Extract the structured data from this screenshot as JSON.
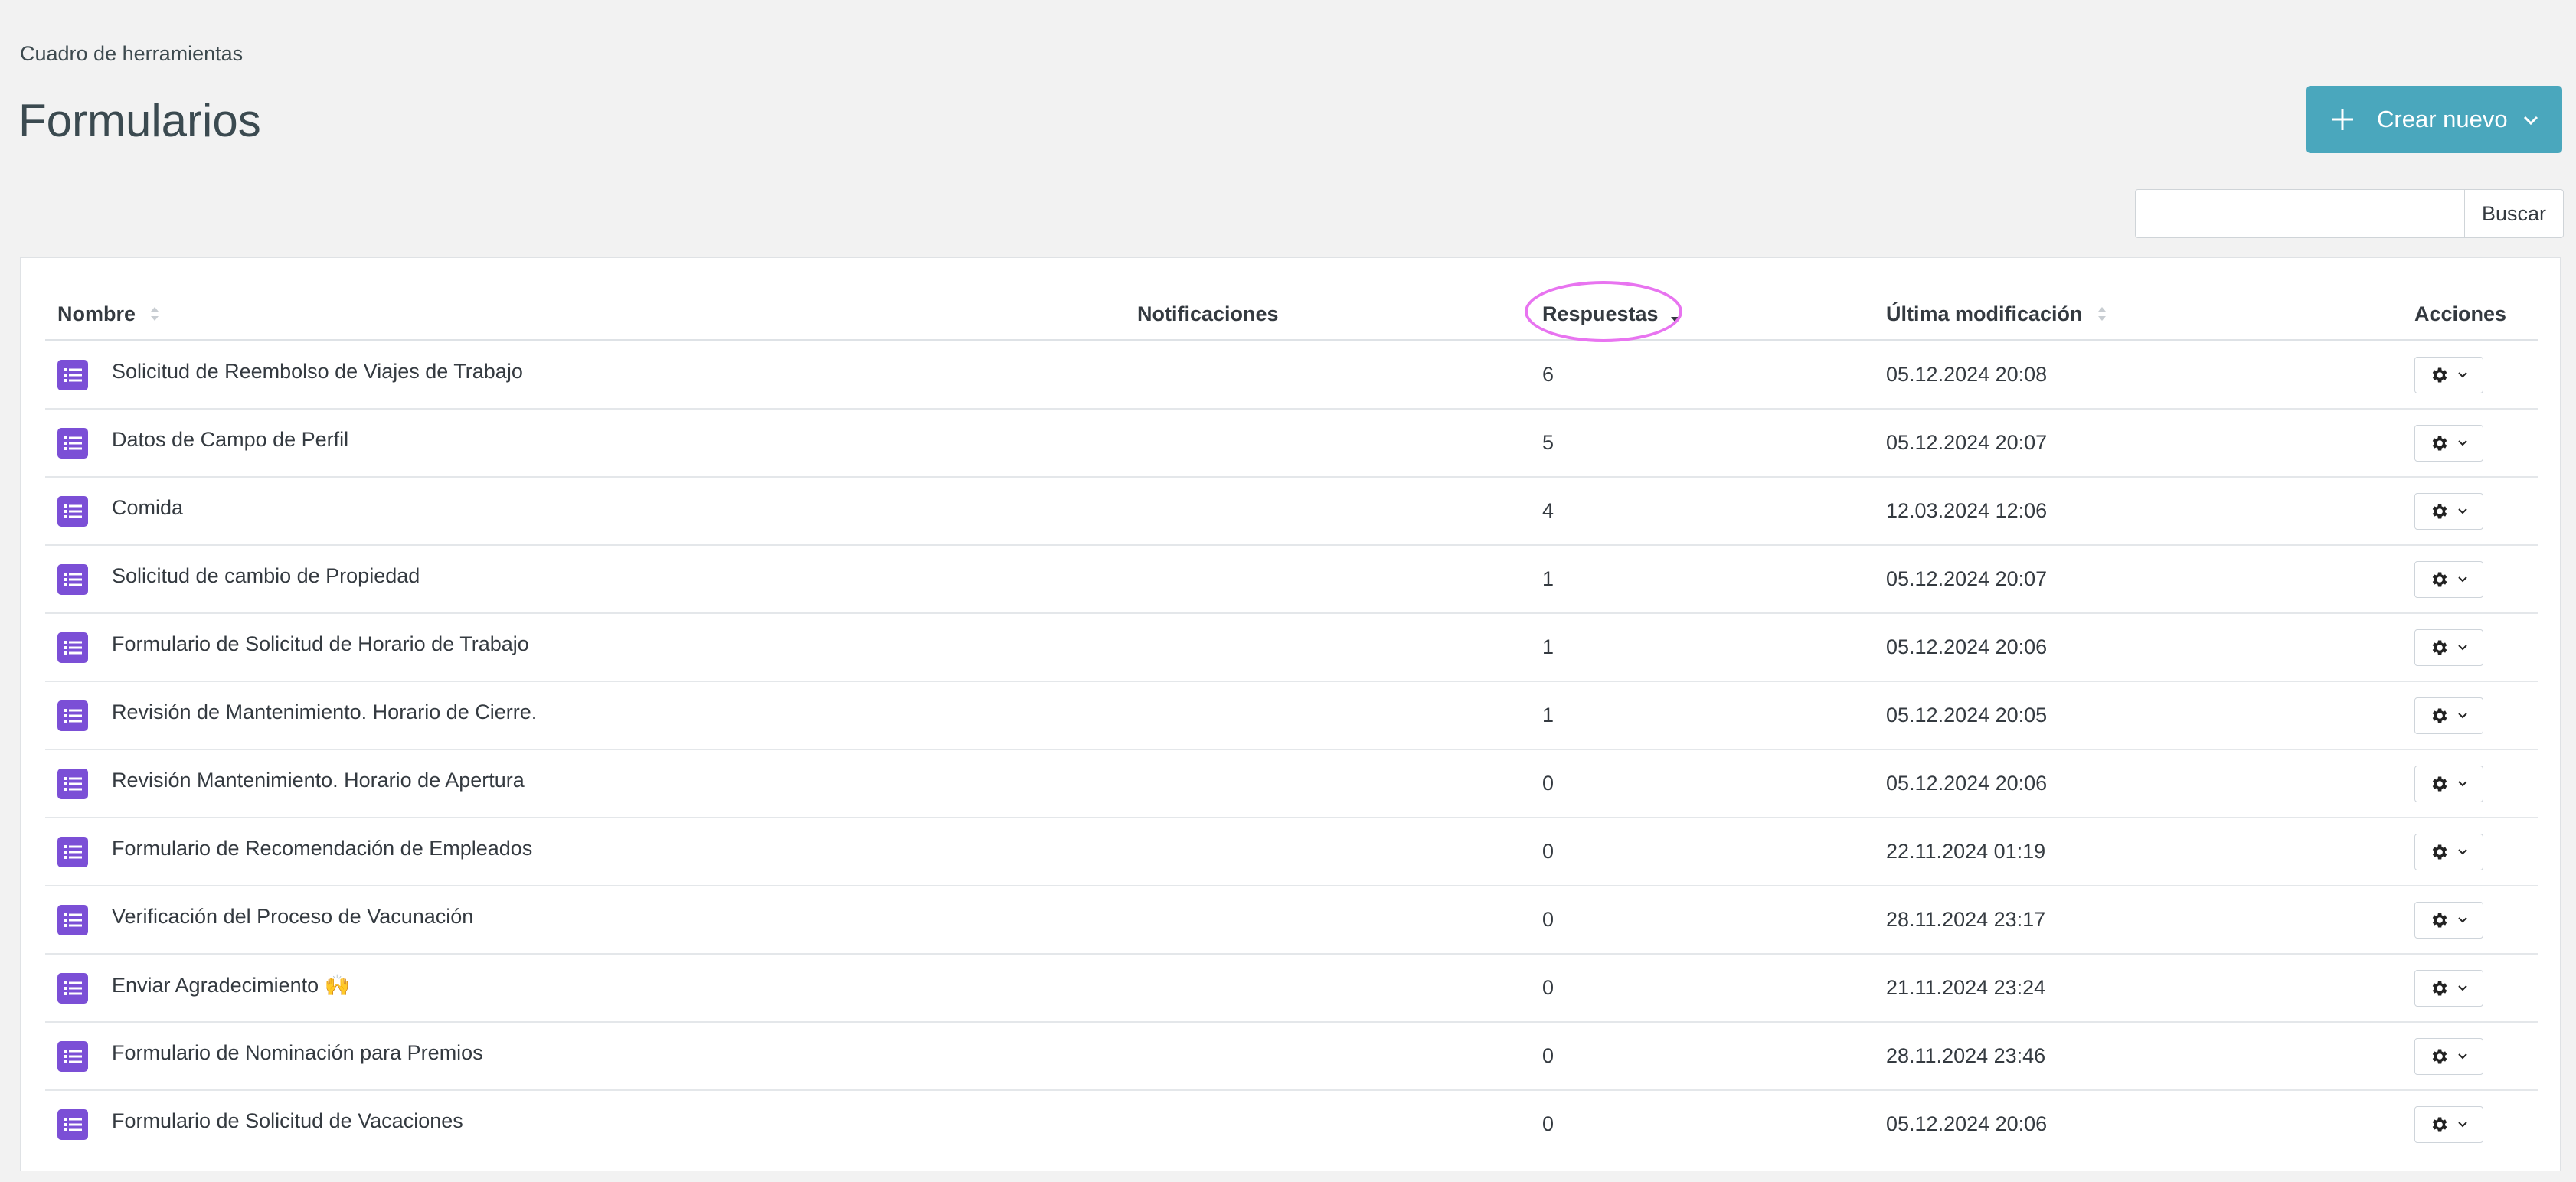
{
  "breadcrumb": "Cuadro de herramientas",
  "title": "Formularios",
  "create_button": {
    "label": "Crear nuevo"
  },
  "search": {
    "placeholder": "",
    "value": "",
    "button_label": "Buscar"
  },
  "colors": {
    "accent": "#4aa7bd",
    "form_icon": "#7b4fd6",
    "highlight": "#e874f0",
    "background": "#f2f2f2"
  },
  "table": {
    "columns": {
      "name": "Nombre",
      "notifications": "Notificaciones",
      "responses": "Respuestas",
      "modified": "Última modificación",
      "actions": "Acciones"
    },
    "sorted_by": "responses",
    "sort_direction": "desc",
    "rows": [
      {
        "name": "Solicitud de Reembolso de Viajes de Trabajo",
        "responses": "6",
        "modified": "05.12.2024 20:08"
      },
      {
        "name": "Datos de Campo de Perfil",
        "responses": "5",
        "modified": "05.12.2024 20:07"
      },
      {
        "name": "Comida",
        "responses": "4",
        "modified": "12.03.2024 12:06"
      },
      {
        "name": "Solicitud de cambio de Propiedad",
        "responses": "1",
        "modified": "05.12.2024 20:07"
      },
      {
        "name": "Formulario de Solicitud de Horario de Trabajo",
        "responses": "1",
        "modified": "05.12.2024 20:06"
      },
      {
        "name": "Revisión de Mantenimiento. Horario de Cierre.",
        "responses": "1",
        "modified": "05.12.2024 20:05"
      },
      {
        "name": "Revisión Mantenimiento. Horario de Apertura",
        "responses": "0",
        "modified": "05.12.2024 20:06"
      },
      {
        "name": "Formulario de Recomendación de Empleados",
        "responses": "0",
        "modified": "22.11.2024 01:19"
      },
      {
        "name": "Verificación del Proceso de Vacunación",
        "responses": "0",
        "modified": "28.11.2024 23:17"
      },
      {
        "name": "Enviar Agradecimiento 🙌",
        "responses": "0",
        "modified": "21.11.2024 23:24"
      },
      {
        "name": "Formulario de Nominación para Premios",
        "responses": "0",
        "modified": "28.11.2024 23:46"
      },
      {
        "name": "Formulario de Solicitud de Vacaciones",
        "responses": "0",
        "modified": "05.12.2024 20:06"
      }
    ]
  }
}
